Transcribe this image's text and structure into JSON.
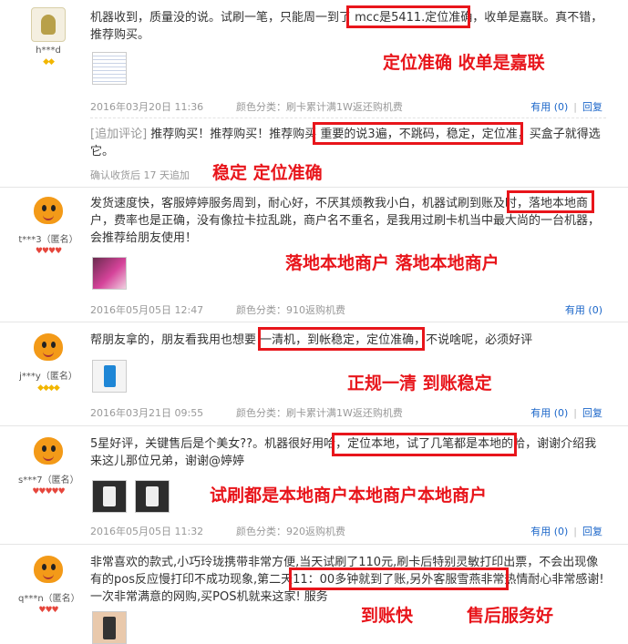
{
  "reviews": [
    {
      "user": "h***d",
      "rank": "◆◆",
      "text": "机器收到，质量没的说。试刷一笔，只能周一到了 mcc是5411.定位准确，收单是嘉联。真不错，推荐购买。",
      "date": "2016年03月20日 11:36",
      "color_class": "颜色分类：刷卡累计满1W返还购机费",
      "useful": "有用 (0)",
      "reply": "回复",
      "annotation": "定位准确 收单是嘉联",
      "followup": {
        "tag": "[追加评论]",
        "text": "推荐购买！推荐购买！推荐购买 重要的说3遍，不跳码，稳定，定位准，买盒子就得选它。",
        "meta": "确认收货后 17 天追加",
        "annotation": "稳定 定位准确"
      }
    },
    {
      "user": "t***3（匿名）",
      "rank": "♥♥♥♥",
      "text": "发货速度快，客服婷婷服务周到，耐心好，不厌其烦教我小白，机器试刷到账及时，落地本地商户，费率也是正确，没有像拉卡拉乱跳，商户名不重名，是我用过刷卡机当中最大尚的一台机器，会推荐给朋友使用！",
      "date": "2016年05月05日 12:47",
      "color_class": "颜色分类：910返购机费",
      "useful": "有用 (0)",
      "annotation": "落地本地商户 落地本地商户"
    },
    {
      "user": "j***y（匿名）",
      "rank": "◆◆◆◆",
      "text": "帮朋友拿的，朋友看我用也想要 一清机，到帐稳定，定位准确，不说啥呢，必须好评",
      "date": "2016年03月21日 09:55",
      "color_class": "颜色分类：刷卡累计满1W返还购机费",
      "useful": "有用 (0)",
      "reply": "回复",
      "annotation": "正规一清 到账稳定"
    },
    {
      "user": "s***7（匿名）",
      "rank": "♥♥♥♥♥",
      "text": "5星好评，关键售后是个美女??。机器很好用哈，定位本地，试了几笔都是本地的哈，谢谢介绍我来这儿那位兄弟，谢谢@婷婷",
      "date": "2016年05月05日 11:32",
      "color_class": "颜色分类：920返购机费",
      "useful": "有用 (0)",
      "reply": "回复",
      "annotation": "试刷都是本地商户本地商户本地商户"
    },
    {
      "user": "q***n（匿名）",
      "rank": "♥♥♥",
      "text": "非常喜欢的款式,小巧玲珑携带非常方便,当天试刷了110元,刷卡后特别灵敏打印出票，不会出现像有的pos反应慢打印不成功现象,第二天11：00多钟就到了账,另外客服雪燕非常热情耐心非常感谢!一次非常满意的网购,买POS机就来这家! 服务",
      "annotation_a": "到账快",
      "annotation_b": "售后服务好"
    }
  ]
}
